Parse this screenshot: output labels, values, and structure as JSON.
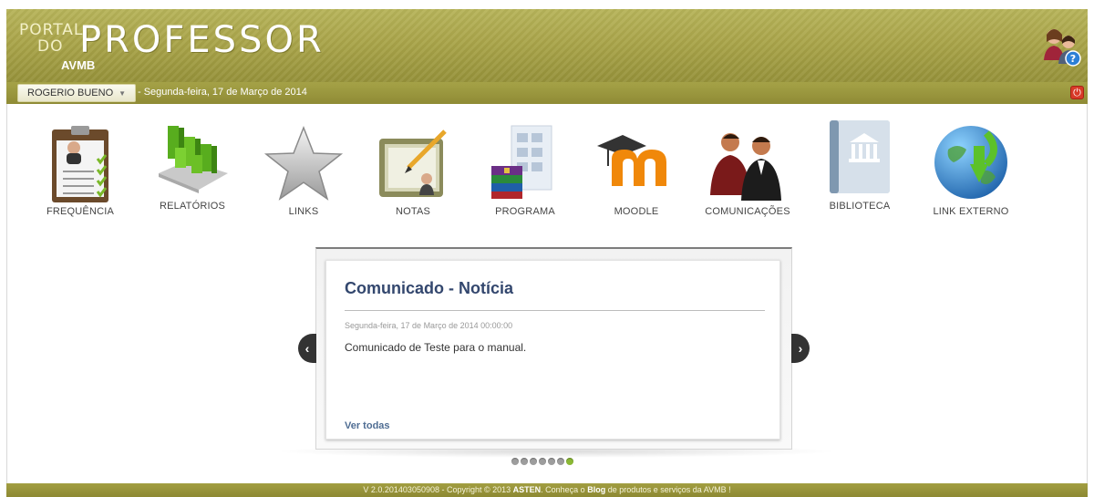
{
  "header": {
    "logo_small_1": "PORTAL",
    "logo_small_2": "DO",
    "logo_big": "PROFESSOR",
    "logo_sub": "AVMB",
    "help_icon": "user-help-icon"
  },
  "toolbar": {
    "user_name": "ROGERIO BUENO",
    "date_text": "- Segunda-feira, 17 de Março de 2014",
    "logout_icon": "power-icon"
  },
  "menu": {
    "items": [
      {
        "label": "FREQUÊNCIA",
        "icon": "attendance-clipboard-icon"
      },
      {
        "label": "RELATÓRIOS",
        "icon": "reports-chart-icon"
      },
      {
        "label": "LINKS",
        "icon": "star-icon"
      },
      {
        "label": "NOTAS",
        "icon": "grades-folder-icon"
      },
      {
        "label": "PROGRAMA",
        "icon": "program-books-icon"
      },
      {
        "label": "MOODLE",
        "icon": "moodle-icon"
      },
      {
        "label": "COMUNICAÇÕES",
        "icon": "people-communication-icon"
      },
      {
        "label": "BIBLIOTECA",
        "icon": "library-book-icon"
      },
      {
        "label": "LINK EXTERNO",
        "icon": "globe-download-icon"
      }
    ]
  },
  "carousel": {
    "title": "Comunicado - Notícia",
    "date": "Segunda-feira, 17 de Março de 2014 00:00:00",
    "body": "Comunicado de Teste para o manual.",
    "link": "Ver todas",
    "prev": "‹",
    "next": "›",
    "dots_count": 7,
    "active_dot": 7
  },
  "footer": {
    "prefix": "V 2.0.201403050908 - Copyright © 2013 ",
    "brand": "ASTEN",
    "middle": ". Conheça o ",
    "blog": "Blog",
    "suffix": " de produtos e serviços da AVMB !"
  },
  "colors": {
    "header": "#aaa54a",
    "accent_green": "#8ab834",
    "title_blue": "#33476e"
  }
}
